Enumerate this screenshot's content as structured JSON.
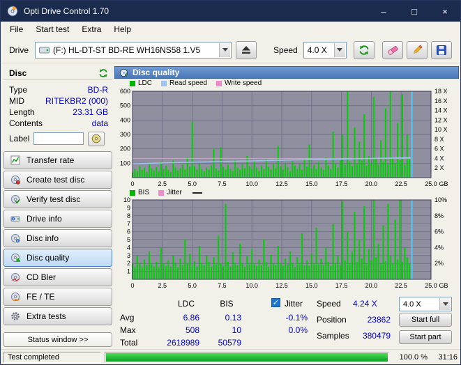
{
  "window": {
    "title": "Opti Drive Control 1.70",
    "controls": {
      "minimize": "–",
      "maximize": "□",
      "close": "×"
    }
  },
  "menubar": {
    "items": [
      "File",
      "Start test",
      "Extra",
      "Help"
    ]
  },
  "toolbar": {
    "drive_label": "Drive",
    "drive_value": "(F:)  HL-DT-ST BD-RE  WH16NS58 1.V5",
    "speed_label": "Speed",
    "speed_value": "4.0 X"
  },
  "sidebar": {
    "header": "Disc",
    "info": [
      {
        "label": "Type",
        "value": "BD-R"
      },
      {
        "label": "MID",
        "value": "RITEKBR2 (000)"
      },
      {
        "label": "Length",
        "value": "23.31 GB"
      },
      {
        "label": "Contents",
        "value": "data"
      }
    ],
    "label_field": {
      "label": "Label",
      "value": ""
    },
    "buttons": [
      {
        "label": "Transfer rate"
      },
      {
        "label": "Create test disc"
      },
      {
        "label": "Verify test disc"
      },
      {
        "label": "Drive info"
      },
      {
        "label": "Disc info"
      },
      {
        "label": "Disc quality"
      },
      {
        "label": "CD Bler"
      },
      {
        "label": "FE / TE"
      },
      {
        "label": "Extra tests"
      }
    ],
    "status_window": "Status window >>"
  },
  "panel": {
    "title": "Disc quality"
  },
  "chart_data": [
    {
      "type": "bar",
      "title": "LDC / read-write speed vs position",
      "legend": [
        {
          "label": "LDC",
          "color": "#00b400"
        },
        {
          "label": "Read speed",
          "color": "#9cc4ee"
        },
        {
          "label": "Write speed",
          "color": "#ee8cc8"
        }
      ],
      "x_range": [
        0,
        25
      ],
      "x_tick_step": 2.5,
      "x_ticks": [
        "0",
        "2.5",
        "5.0",
        "7.5",
        "10.0",
        "12.5",
        "15.0",
        "17.5",
        "20.0",
        "22.5",
        "25.0"
      ],
      "x_unit": "GB",
      "y_range": [
        0,
        600
      ],
      "y_ticks_left": [
        {
          "label": "600",
          "v": 600
        },
        {
          "label": "500",
          "v": 500
        },
        {
          "label": "400",
          "v": 400
        },
        {
          "label": "300",
          "v": 300
        },
        {
          "label": "200",
          "v": 200
        },
        {
          "label": "100",
          "v": 100
        }
      ],
      "y_ticks_right": [
        {
          "label": "18 X",
          "v": 600
        },
        {
          "label": "16 X",
          "v": 533
        },
        {
          "label": "14 X",
          "v": 467
        },
        {
          "label": "12 X",
          "v": 400
        },
        {
          "label": "10 X",
          "v": 333
        },
        {
          "label": "8 X",
          "v": 267
        },
        {
          "label": "6 X",
          "v": 200
        },
        {
          "label": "4 X",
          "v": 133
        },
        {
          "label": "2 X",
          "v": 67
        }
      ],
      "bar_step": 0.2,
      "bar_color": "#00d000",
      "bars": [
        35,
        60,
        45,
        80,
        55,
        70,
        40,
        95,
        65,
        50,
        75,
        45,
        110,
        60,
        85,
        55,
        40,
        120,
        70,
        50,
        65,
        90,
        55,
        140,
        75,
        390,
        80,
        55,
        95,
        60,
        45,
        70,
        55,
        85,
        200,
        65,
        50,
        210,
        75,
        55,
        90,
        60,
        45,
        120,
        70,
        55,
        95,
        65,
        150,
        80,
        60,
        110,
        70,
        45,
        85,
        60,
        130,
        75,
        55,
        95,
        65,
        220,
        80,
        55,
        100,
        70,
        45,
        115,
        85,
        60,
        95,
        55,
        130,
        75,
        230,
        65,
        90,
        60,
        110,
        70,
        55,
        140,
        85,
        60,
        320,
        95,
        70,
        120,
        300,
        90,
        600,
        110,
        80,
        350,
        95,
        250,
        120,
        440,
        85,
        150,
        100,
        560,
        130,
        90,
        260,
        110,
        480,
        95,
        600,
        140,
        100,
        380,
        120,
        580,
        90,
        300,
        130,
        80,
        0,
        0,
        0,
        0,
        0,
        0,
        0
      ],
      "lines": [
        {
          "name": "write-speed",
          "color": "#ee8cc8",
          "width": 1.2,
          "points": [
            [
              0,
              133
            ],
            [
              23.3,
              133
            ]
          ]
        },
        {
          "name": "read-speed",
          "color": "#9cc4ee",
          "width": 1.5,
          "points": [
            [
              0,
              96
            ],
            [
              2.5,
              102
            ],
            [
              5,
              107
            ],
            [
              7.5,
              112
            ],
            [
              10,
              116
            ],
            [
              12.5,
              121
            ],
            [
              15,
              125
            ],
            [
              17.5,
              129
            ],
            [
              20,
              133
            ],
            [
              22.5,
              137
            ],
            [
              23.3,
              139
            ]
          ]
        }
      ],
      "vline": {
        "x": 23.4,
        "color": "#55c8f5"
      }
    },
    {
      "type": "bar",
      "title": "BIS / jitter vs position",
      "legend": [
        {
          "label": "BIS",
          "color": "#00b400"
        },
        {
          "label": "Jitter",
          "color": "#ee8cc8"
        }
      ],
      "legend_dash": true,
      "x_range": [
        0,
        25
      ],
      "x_tick_step": 2.5,
      "x_ticks": [
        "0",
        "2.5",
        "5.0",
        "7.5",
        "10.0",
        "12.5",
        "15.0",
        "17.5",
        "20.0",
        "22.5",
        "25.0"
      ],
      "x_unit": "GB",
      "y_range": [
        0,
        10
      ],
      "y_ticks_left": [
        {
          "label": "10",
          "v": 10
        },
        {
          "label": "9",
          "v": 9
        },
        {
          "label": "8",
          "v": 8
        },
        {
          "label": "7",
          "v": 7
        },
        {
          "label": "6",
          "v": 6
        },
        {
          "label": "5",
          "v": 5
        },
        {
          "label": "4",
          "v": 4
        },
        {
          "label": "3",
          "v": 3
        },
        {
          "label": "2",
          "v": 2
        },
        {
          "label": "1",
          "v": 1
        }
      ],
      "y_ticks_right": [
        {
          "label": "10%",
          "v": 10
        },
        {
          "label": "8%",
          "v": 8
        },
        {
          "label": "6%",
          "v": 6
        },
        {
          "label": "4%",
          "v": 4
        },
        {
          "label": "2%",
          "v": 2
        }
      ],
      "bar_step": 0.2,
      "bar_color": "#00d000",
      "bars": [
        2,
        1.5,
        3,
        2,
        1.5,
        2.5,
        1.8,
        3.5,
        2,
        1.6,
        2.2,
        1.5,
        4,
        2,
        1.7,
        2.4,
        1.6,
        3,
        2.1,
        1.5,
        2.6,
        1.8,
        5,
        2,
        3.2,
        1.7,
        2.3,
        1.6,
        4.2,
        2,
        1.8,
        3,
        2.2,
        1.6,
        2.8,
        1.9,
        5.5,
        2,
        1.7,
        9.5,
        2.2,
        1.6,
        3.4,
        2,
        1.8,
        4.5,
        2.1,
        1.6,
        2.9,
        1.9,
        3.8,
        2,
        1.7,
        2.5,
        1.8,
        5,
        2.2,
        1.6,
        3.1,
        2,
        1.8,
        4.2,
        2,
        1.7,
        2.6,
        1.9,
        3.5,
        2.1,
        1.6,
        2.8,
        2,
        5.8,
        1.8,
        2.4,
        1.7,
        3.2,
        2,
        6.5,
        1.9,
        2.6,
        1.8,
        4,
        2.2,
        1.7,
        7,
        2,
        3,
        1.8,
        9.8,
        2.4,
        6,
        2,
        3.5,
        8.5,
        2.2,
        5,
        2.6,
        9.2,
        2,
        3.8,
        2.4,
        10,
        2.8,
        4.5,
        2,
        6.8,
        2.3,
        9.5,
        3,
        2,
        7.5,
        2.5,
        10,
        2.2,
        4,
        2.8,
        2,
        1.8,
        0,
        0,
        0,
        0,
        0,
        0,
        0
      ],
      "lines": [],
      "vline": {
        "x": 23.4,
        "color": "#55c8f5"
      }
    }
  ],
  "stats": {
    "col_ldc": "LDC",
    "col_bis": "BIS",
    "rows": [
      {
        "label": "Avg",
        "ldc": "6.86",
        "bis": "0.13"
      },
      {
        "label": "Max",
        "ldc": "508",
        "bis": "10"
      },
      {
        "label": "Total",
        "ldc": "2618989",
        "bis": "50579"
      }
    ],
    "jitter": {
      "label": "Jitter",
      "checked": true,
      "check": "✓",
      "values": [
        "-0.1%",
        "0.0%"
      ]
    },
    "speed_label": "Speed",
    "speed_value": "4.24 X",
    "speed_combo": "4.0 X",
    "position_label": "Position",
    "position_value": "23862",
    "samples_label": "Samples",
    "samples_value": "380479",
    "start_full": "Start full",
    "start_part": "Start part"
  },
  "statusbar": {
    "text": "Test completed",
    "percent": "100.0 %",
    "time": "31:16"
  },
  "colors": {
    "value_blue": "#0000cc",
    "bar_green": "#00d000",
    "read_blue": "#9cc4ee",
    "write_pink": "#ee8cc8",
    "marker_cyan": "#55c8f5",
    "progress_green": "#14b42a",
    "titlebar_blue": "#1b2b4d",
    "plot_background": "#8f8fa0"
  }
}
